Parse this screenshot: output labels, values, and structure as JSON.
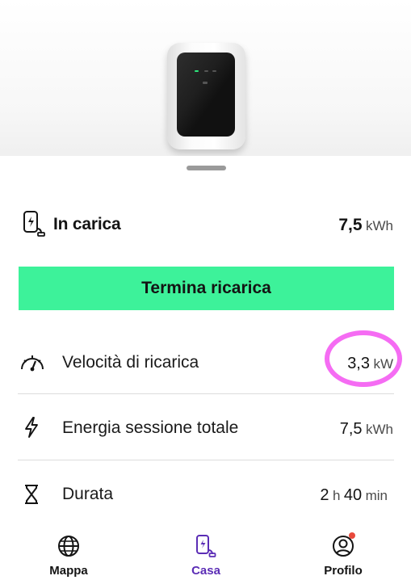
{
  "status": {
    "label": "In carica",
    "energy_value": "7,5",
    "energy_unit": "kWh"
  },
  "stop_button": {
    "label": "Termina ricarica",
    "color": "#3df29a"
  },
  "info_rows": [
    {
      "icon": "speedometer-icon",
      "label": "Velocità di ricarica",
      "value": "3,3",
      "unit": "kW"
    },
    {
      "icon": "lightning-icon",
      "label": "Energia sessione totale",
      "value": "7,5",
      "unit": "kWh"
    },
    {
      "icon": "hourglass-icon",
      "label": "Durata",
      "hours": "2",
      "hours_unit": "h",
      "minutes": "40",
      "minutes_unit": "min"
    }
  ],
  "highlight_color": "#f56cf3",
  "nav": {
    "items": [
      {
        "label": "Mappa",
        "icon": "globe-icon",
        "active": false
      },
      {
        "label": "Casa",
        "icon": "home-charger-icon",
        "active": true
      },
      {
        "label": "Profilo",
        "icon": "profile-icon",
        "active": false,
        "has_notification": true
      }
    ],
    "active_color": "#5b2db5",
    "notification_color": "#e84a3c"
  }
}
